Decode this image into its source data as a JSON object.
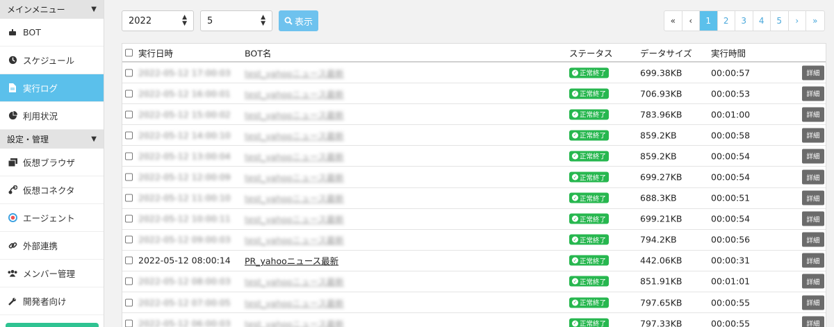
{
  "sidebar": {
    "main_menu": "メインメニュー",
    "items": [
      {
        "label": "BOT",
        "icon": "robot-icon"
      },
      {
        "label": "スケジュール",
        "icon": "clock-icon"
      },
      {
        "label": "実行ログ",
        "icon": "file-icon",
        "active": true
      },
      {
        "label": "利用状況",
        "icon": "pie-chart-icon"
      }
    ],
    "settings_menu": "設定・管理",
    "settings_items": [
      {
        "label": "仮想ブラウザ",
        "icon": "browser-icon"
      },
      {
        "label": "仮想コネクタ",
        "icon": "connector-icon"
      },
      {
        "label": "エージェント",
        "icon": "agent-icon"
      },
      {
        "label": "外部連携",
        "icon": "link-icon"
      },
      {
        "label": "メンバー管理",
        "icon": "users-icon"
      },
      {
        "label": "開発者向け",
        "icon": "wrench-icon"
      }
    ]
  },
  "toolbar": {
    "year": "2022",
    "month": "5",
    "show_label": "表示"
  },
  "pager": {
    "first": "«",
    "prev": "‹",
    "pages": [
      "1",
      "2",
      "3",
      "4",
      "5"
    ],
    "next": "›",
    "last": "»",
    "current": "1"
  },
  "table": {
    "headers": {
      "date": "実行日時",
      "bot": "BOT名",
      "status": "ステータス",
      "size": "データサイズ",
      "time": "実行時間"
    },
    "detail_label": "詳細",
    "rows": [
      {
        "date": "2022-05-12 17:00:03",
        "bot": "test_yahooニュース最新",
        "status": "正常終了",
        "size": "699.38KB",
        "time": "00:00:57",
        "blurred": true
      },
      {
        "date": "2022-05-12 16:00:01",
        "bot": "test_yahooニュース最新",
        "status": "正常終了",
        "size": "706.93KB",
        "time": "00:00:53",
        "blurred": true
      },
      {
        "date": "2022-05-12 15:00:02",
        "bot": "test_yahooニュース最新",
        "status": "正常終了",
        "size": "783.96KB",
        "time": "00:01:00",
        "blurred": true
      },
      {
        "date": "2022-05-12 14:00:10",
        "bot": "test_yahooニュース最新",
        "status": "正常終了",
        "size": "859.2KB",
        "time": "00:00:58",
        "blurred": true
      },
      {
        "date": "2022-05-12 13:00:04",
        "bot": "test_yahooニュース最新",
        "status": "正常終了",
        "size": "859.2KB",
        "time": "00:00:54",
        "blurred": true
      },
      {
        "date": "2022-05-12 12:00:09",
        "bot": "test_yahooニュース最新",
        "status": "正常終了",
        "size": "699.27KB",
        "time": "00:00:54",
        "blurred": true
      },
      {
        "date": "2022-05-12 11:00:10",
        "bot": "test_yahooニュース最新",
        "status": "正常終了",
        "size": "688.3KB",
        "time": "00:00:51",
        "blurred": true
      },
      {
        "date": "2022-05-12 10:00:11",
        "bot": "test_yahooニュース最新",
        "status": "正常終了",
        "size": "699.21KB",
        "time": "00:00:54",
        "blurred": true
      },
      {
        "date": "2022-05-12 09:00:03",
        "bot": "test_yahooニュース最新",
        "status": "正常終了",
        "size": "794.2KB",
        "time": "00:00:56",
        "blurred": true
      },
      {
        "date": "2022-05-12 08:00:14",
        "bot": "PR_yahooニュース最新",
        "status": "正常終了",
        "size": "442.06KB",
        "time": "00:00:31",
        "blurred": false
      },
      {
        "date": "2022-05-12 08:00:03",
        "bot": "test_yahooニュース最新",
        "status": "正常終了",
        "size": "851.91KB",
        "time": "00:01:01",
        "blurred": true
      },
      {
        "date": "2022-05-12 07:00:05",
        "bot": "test_yahooニュース最新",
        "status": "正常終了",
        "size": "797.65KB",
        "time": "00:00:55",
        "blurred": true
      },
      {
        "date": "2022-05-12 06:00:03",
        "bot": "test_yahooニュース最新",
        "status": "正常終了",
        "size": "797.33KB",
        "time": "00:00:55",
        "blurred": true
      }
    ]
  }
}
